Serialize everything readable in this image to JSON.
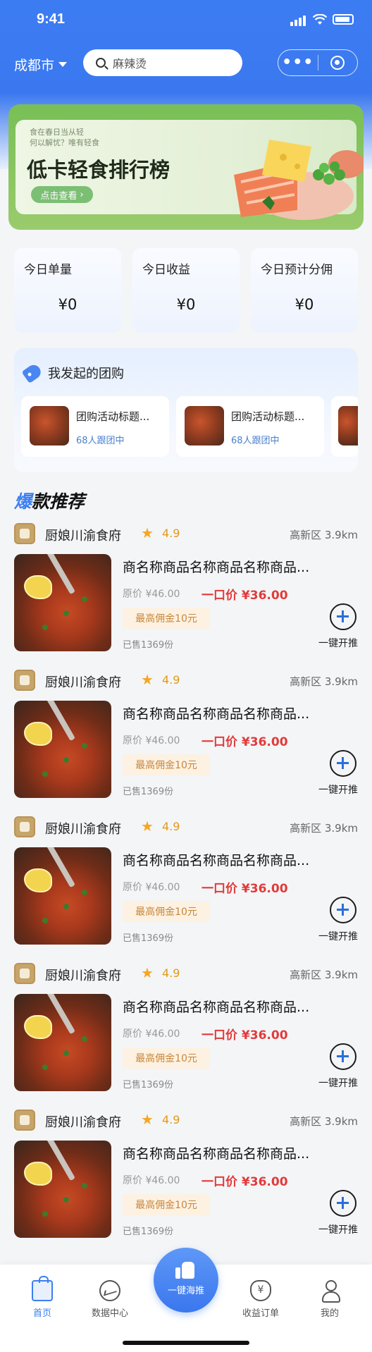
{
  "status_bar": {
    "time": "9:41"
  },
  "nav": {
    "city": "成都市",
    "search_value": "麻辣烫"
  },
  "banner": {
    "small_text_1": "食在春日当从轻",
    "small_text_2": "何以解忧？唯有轻食",
    "title": "低卡轻食排行榜",
    "button_label": "点击查看"
  },
  "stats": [
    {
      "label": "今日单量",
      "value": "¥0"
    },
    {
      "label": "今日收益",
      "value": "¥0"
    },
    {
      "label": "今日预计分佣",
      "value": "¥0"
    }
  ],
  "group_buy": {
    "title": "我发起的团购",
    "cards": [
      {
        "title": "团购活动标题...",
        "status": "68人跟团中"
      },
      {
        "title": "团购活动标题...",
        "status": "68人跟团中"
      }
    ]
  },
  "hot": {
    "title_accent": "爆",
    "title_rest": "款推荐"
  },
  "products": [
    {
      "shop": "厨娘川渝食府",
      "rating": "4.9",
      "distance": "高新区 3.9km",
      "name": "商名称商品名称商品名称商品...",
      "original_price": "原价 ¥46.00",
      "deal_price": "一口价 ¥36.00",
      "commission": "最高佣金10元",
      "sold": "已售1369份",
      "action": "一键开推"
    },
    {
      "shop": "厨娘川渝食府",
      "rating": "4.9",
      "distance": "高新区 3.9km",
      "name": "商名称商品名称商品名称商品...",
      "original_price": "原价 ¥46.00",
      "deal_price": "一口价 ¥36.00",
      "commission": "最高佣金10元",
      "sold": "已售1369份",
      "action": "一键开推"
    },
    {
      "shop": "厨娘川渝食府",
      "rating": "4.9",
      "distance": "高新区 3.9km",
      "name": "商名称商品名称商品名称商品...",
      "original_price": "原价 ¥46.00",
      "deal_price": "一口价 ¥36.00",
      "commission": "最高佣金10元",
      "sold": "已售1369份",
      "action": "一键开推"
    },
    {
      "shop": "厨娘川渝食府",
      "rating": "4.9",
      "distance": "高新区 3.9km",
      "name": "商名称商品名称商品名称商品...",
      "original_price": "原价 ¥46.00",
      "deal_price": "一口价 ¥36.00",
      "commission": "最高佣金10元",
      "sold": "已售1369份",
      "action": "一键开推"
    },
    {
      "shop": "厨娘川渝食府",
      "rating": "4.9",
      "distance": "高新区 3.9km",
      "name": "商名称商品名称商品名称商品...",
      "original_price": "原价 ¥46.00",
      "deal_price": "一口价 ¥36.00",
      "commission": "最高佣金10元",
      "sold": "已售1369份",
      "action": "一键开推"
    }
  ],
  "tabbar": {
    "home": "首页",
    "data_center": "数据中心",
    "center_button": "一键海推",
    "income_orders": "收益订单",
    "mine": "我的"
  },
  "colors": {
    "primary": "#3b7ff0",
    "price_red": "#e23a3a",
    "commission": "#c8873a",
    "rating": "#f5a623"
  }
}
